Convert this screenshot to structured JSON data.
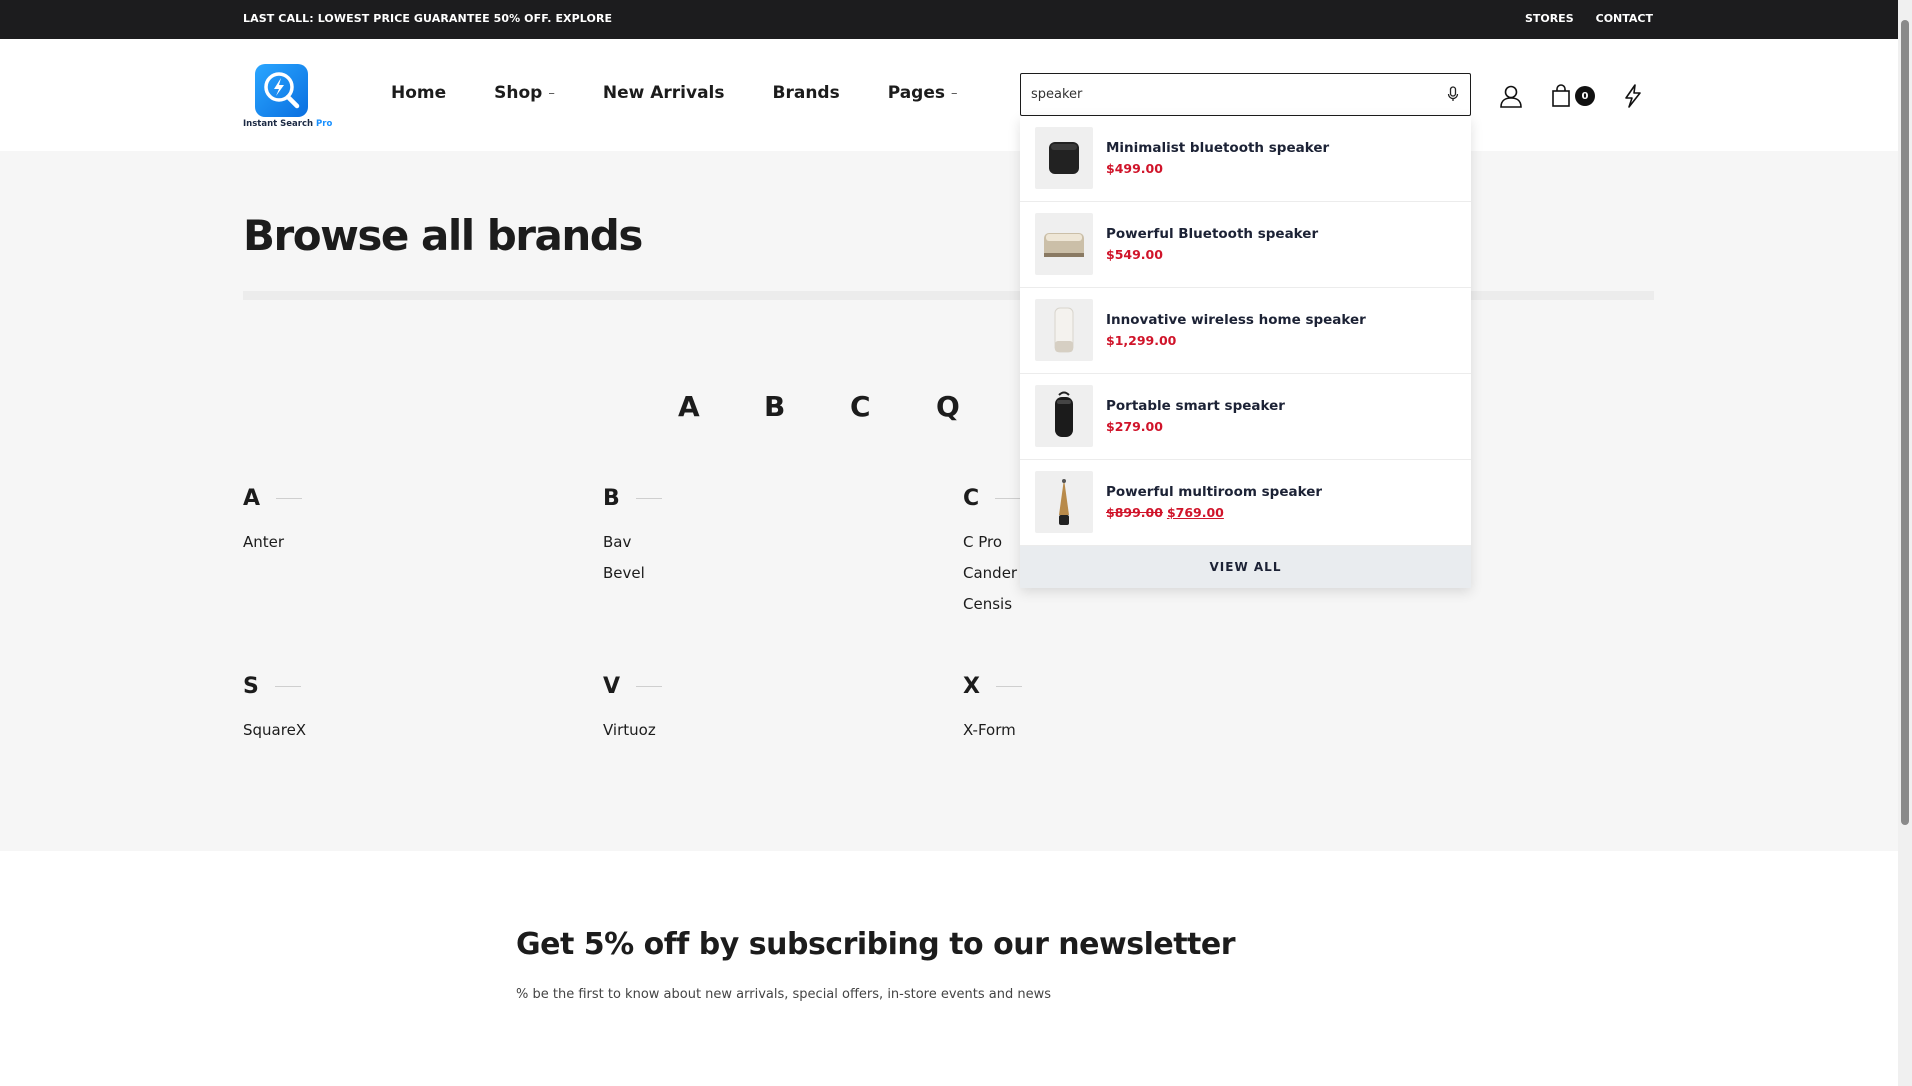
{
  "topbar": {
    "promo": "LAST CALL: LOWEST PRICE GUARANTEE 50% OFF. EXPLORE",
    "stores": "STORES",
    "contact": "CONTACT"
  },
  "logo": {
    "name": "Instant Search",
    "suffix": "Pro"
  },
  "nav": {
    "home": "Home",
    "shop": "Shop",
    "new_arrivals": "New Arrivals",
    "brands": "Brands",
    "pages": "Pages",
    "dropdown_marker": "–"
  },
  "search": {
    "value": "speaker",
    "icon": "mic-icon"
  },
  "header_icons": {
    "account": "user-icon",
    "cart": "bag-icon",
    "cart_count": "0",
    "quick": "bolt-icon"
  },
  "page": {
    "title": "Browse all brands",
    "letters": [
      "A",
      "B",
      "C",
      "Q"
    ]
  },
  "brand_groups": [
    {
      "letter": "A",
      "brands": [
        "Anter"
      ]
    },
    {
      "letter": "B",
      "brands": [
        "Bav",
        "Bevel"
      ]
    },
    {
      "letter": "C",
      "brands": [
        "C Pro",
        "Cander",
        "Censis"
      ]
    },
    {
      "letter": "S",
      "brands": [
        "SquareX"
      ]
    },
    {
      "letter": "V",
      "brands": [
        "Virtuoz"
      ]
    },
    {
      "letter": "X",
      "brands": [
        "X-Form"
      ]
    }
  ],
  "results": [
    {
      "name": "Minimalist bluetooth speaker",
      "price": "$499.00",
      "old_price": ""
    },
    {
      "name": "Powerful Bluetooth speaker",
      "price": "$549.00",
      "old_price": ""
    },
    {
      "name": "Innovative wireless home speaker",
      "price": "$1,299.00",
      "old_price": ""
    },
    {
      "name": "Portable smart speaker",
      "price": "$279.00",
      "old_price": ""
    },
    {
      "name": "Powerful multiroom speaker",
      "price": "$769.00",
      "old_price": "$899.00"
    }
  ],
  "view_all": "VIEW ALL",
  "newsletter": {
    "title": "Get 5% off by subscribing to our newsletter",
    "subtitle": "% be the first to know about new arrivals, special offers, in-store events and news"
  },
  "colors": {
    "accent": "#d0142a",
    "topbar": "#1c1c1e",
    "logo": "#1890ff"
  }
}
